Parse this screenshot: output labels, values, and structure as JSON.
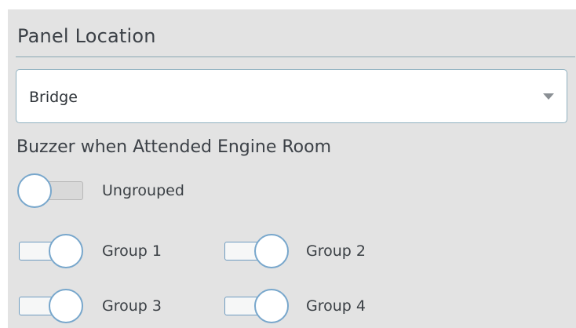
{
  "panel_location": {
    "title": "Panel Location",
    "select": {
      "value": "Bridge",
      "arrow_icon": "chevron-down-icon"
    }
  },
  "buzzer": {
    "heading": "Buzzer when Attended Engine Room",
    "toggles": [
      {
        "label": "Ungrouped",
        "state": "off"
      },
      {
        "label": "Group 1",
        "state": "on"
      },
      {
        "label": "Group 2",
        "state": "on"
      },
      {
        "label": "Group 3",
        "state": "on"
      },
      {
        "label": "Group 4",
        "state": "on"
      }
    ]
  },
  "colors": {
    "panel_background": "#e3e3e3",
    "accent_border": "#78a7cc",
    "divider": "#8aa7b3"
  }
}
